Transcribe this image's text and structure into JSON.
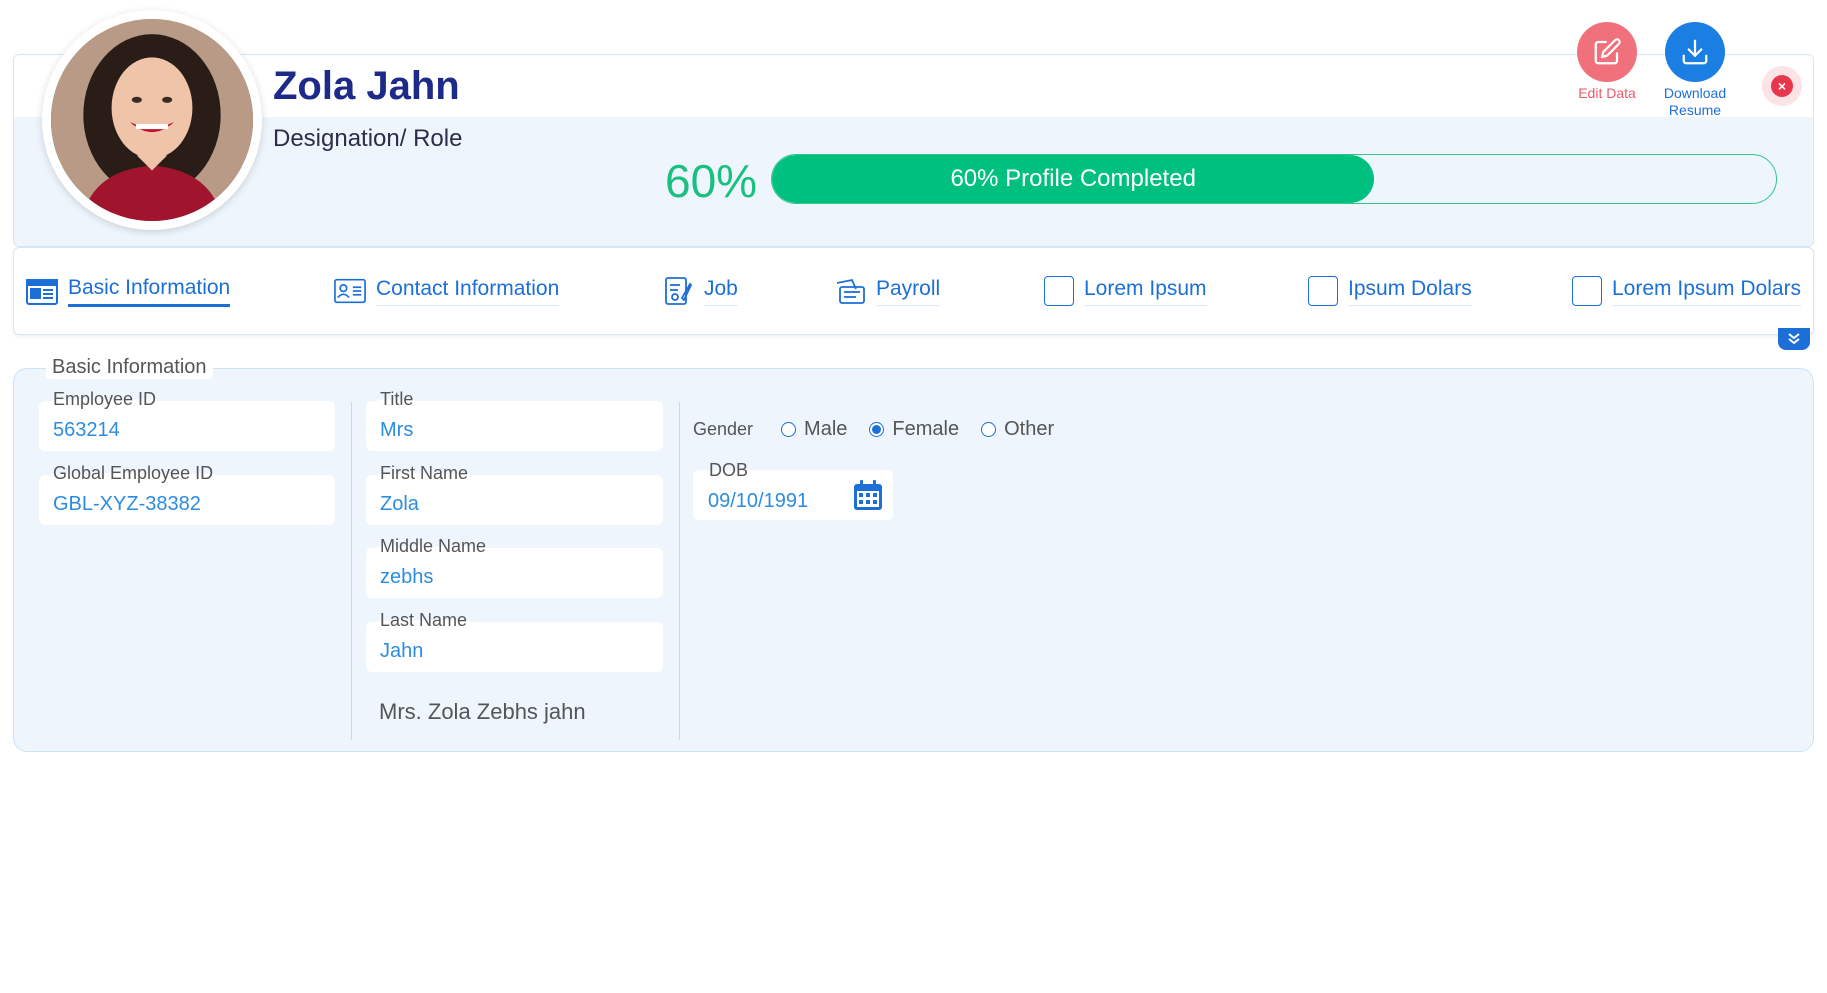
{
  "profile": {
    "name": "Zola Jahn",
    "role": "Designation/ Role",
    "completion_percent": 60,
    "completion_text": "60%",
    "progress_label": "60% Profile Completed"
  },
  "actions": {
    "edit_label": "Edit Data",
    "download_label_line1": "Download",
    "download_label_line2": "Resume"
  },
  "tabs": [
    {
      "label": "Basic Information",
      "icon": "news-card-icon",
      "active": true
    },
    {
      "label": "Contact Information",
      "icon": "id-card-icon",
      "active": false
    },
    {
      "label": "Job",
      "icon": "job-document-icon",
      "active": false
    },
    {
      "label": "Payroll",
      "icon": "payroll-icon",
      "active": false
    },
    {
      "label": "Lorem Ipsum",
      "icon": "empty-box-icon",
      "active": false
    },
    {
      "label": "Ipsum Dolars",
      "icon": "empty-box-icon",
      "active": false
    },
    {
      "label": "Lorem Ipsum Dolars",
      "icon": "empty-box-icon",
      "active": false
    }
  ],
  "basic_info": {
    "section_title": "Basic Information",
    "employee_id": {
      "label": "Employee ID",
      "value": "563214"
    },
    "global_employee_id": {
      "label": "Global Employee ID",
      "value": "GBL-XYZ-38382"
    },
    "title": {
      "label": "Title",
      "value": "Mrs"
    },
    "first_name": {
      "label": "First Name",
      "value": "Zola"
    },
    "middle_name": {
      "label": "Middle Name",
      "value": "zebhs"
    },
    "last_name": {
      "label": "Last Name",
      "value": "Jahn"
    },
    "full_name": "Mrs. Zola Zebhs jahn",
    "gender": {
      "label": "Gender",
      "options": [
        "Male",
        "Female",
        "Other"
      ],
      "selected": "Female"
    },
    "dob": {
      "label": "DOB",
      "value": "09/10/1991"
    }
  },
  "colors": {
    "brand_blue": "#1d6fd8",
    "name_navy": "#1e2a8a",
    "success_green": "#00c07f",
    "edit_red": "#f0707c",
    "close_red": "#e8374d"
  }
}
